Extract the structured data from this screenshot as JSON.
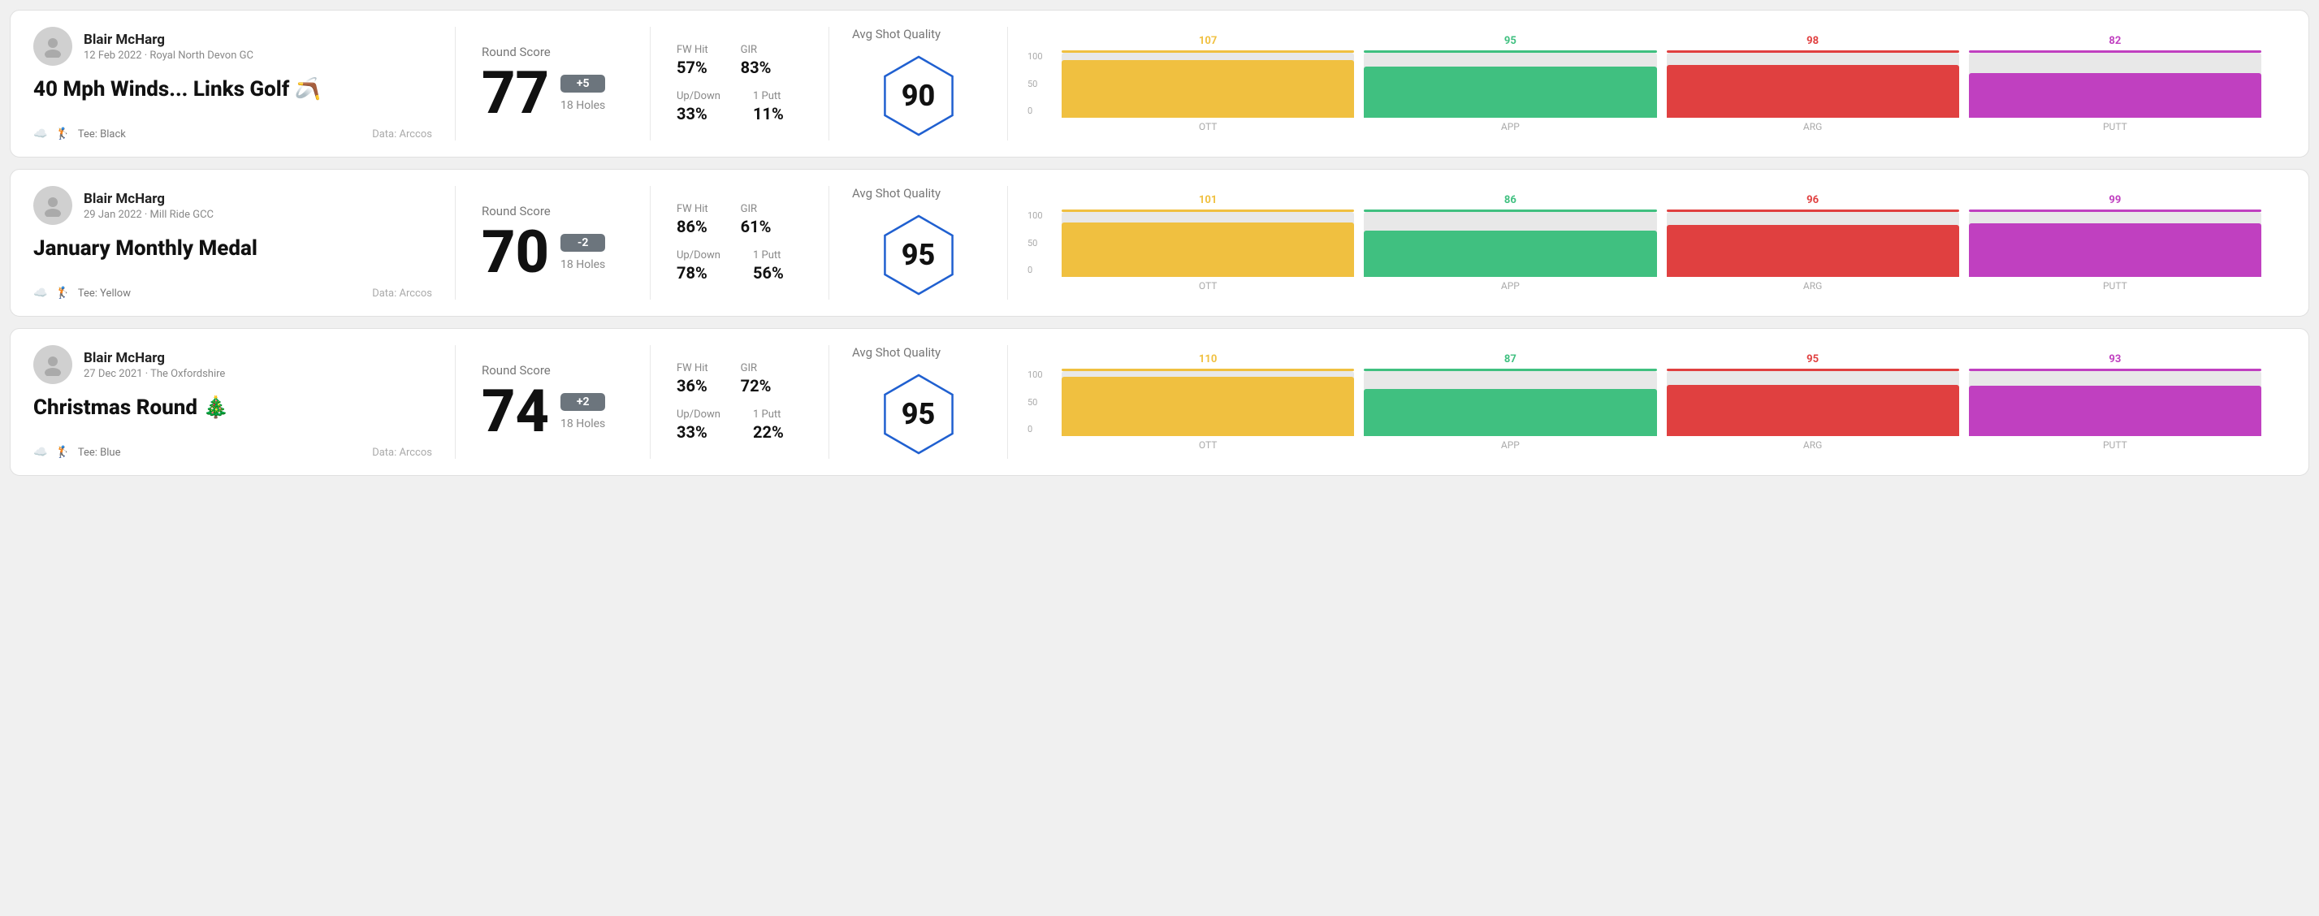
{
  "rounds": [
    {
      "id": "round-1",
      "player": {
        "name": "Blair McHarg",
        "date": "12 Feb 2022",
        "course": "Royal North Devon GC"
      },
      "title": "40 Mph Winds... Links Golf 🪃",
      "tee": "Black",
      "data_source": "Data: Arccos",
      "score": {
        "label": "Round Score",
        "value": "77",
        "modifier": "+5",
        "holes": "18 Holes"
      },
      "stats": {
        "fw_hit_label": "FW Hit",
        "fw_hit_value": "57%",
        "gir_label": "GIR",
        "gir_value": "83%",
        "updown_label": "Up/Down",
        "updown_value": "33%",
        "oneputt_label": "1 Putt",
        "oneputt_value": "11%"
      },
      "quality": {
        "label": "Avg Shot Quality",
        "score": "90"
      },
      "chart": {
        "bars": [
          {
            "label": "OTT",
            "value": 107,
            "color": "#f0c040"
          },
          {
            "label": "APP",
            "value": 95,
            "color": "#40c080"
          },
          {
            "label": "ARG",
            "value": 98,
            "color": "#e04040"
          },
          {
            "label": "PUTT",
            "value": 82,
            "color": "#c040c0"
          }
        ],
        "max": 120,
        "y_labels": [
          "100",
          "50",
          "0"
        ]
      }
    },
    {
      "id": "round-2",
      "player": {
        "name": "Blair McHarg",
        "date": "29 Jan 2022",
        "course": "Mill Ride GCC"
      },
      "title": "January Monthly Medal",
      "tee": "Yellow",
      "data_source": "Data: Arccos",
      "score": {
        "label": "Round Score",
        "value": "70",
        "modifier": "-2",
        "holes": "18 Holes"
      },
      "stats": {
        "fw_hit_label": "FW Hit",
        "fw_hit_value": "86%",
        "gir_label": "GIR",
        "gir_value": "61%",
        "updown_label": "Up/Down",
        "updown_value": "78%",
        "oneputt_label": "1 Putt",
        "oneputt_value": "56%"
      },
      "quality": {
        "label": "Avg Shot Quality",
        "score": "95"
      },
      "chart": {
        "bars": [
          {
            "label": "OTT",
            "value": 101,
            "color": "#f0c040"
          },
          {
            "label": "APP",
            "value": 86,
            "color": "#40c080"
          },
          {
            "label": "ARG",
            "value": 96,
            "color": "#e04040"
          },
          {
            "label": "PUTT",
            "value": 99,
            "color": "#c040c0"
          }
        ],
        "max": 120,
        "y_labels": [
          "100",
          "50",
          "0"
        ]
      }
    },
    {
      "id": "round-3",
      "player": {
        "name": "Blair McHarg",
        "date": "27 Dec 2021",
        "course": "The Oxfordshire"
      },
      "title": "Christmas Round 🎄",
      "tee": "Blue",
      "data_source": "Data: Arccos",
      "score": {
        "label": "Round Score",
        "value": "74",
        "modifier": "+2",
        "holes": "18 Holes"
      },
      "stats": {
        "fw_hit_label": "FW Hit",
        "fw_hit_value": "36%",
        "gir_label": "GIR",
        "gir_value": "72%",
        "updown_label": "Up/Down",
        "updown_value": "33%",
        "oneputt_label": "1 Putt",
        "oneputt_value": "22%"
      },
      "quality": {
        "label": "Avg Shot Quality",
        "score": "95"
      },
      "chart": {
        "bars": [
          {
            "label": "OTT",
            "value": 110,
            "color": "#f0c040"
          },
          {
            "label": "APP",
            "value": 87,
            "color": "#40c080"
          },
          {
            "label": "ARG",
            "value": 95,
            "color": "#e04040"
          },
          {
            "label": "PUTT",
            "value": 93,
            "color": "#c040c0"
          }
        ],
        "max": 120,
        "y_labels": [
          "100",
          "50",
          "0"
        ]
      }
    }
  ]
}
